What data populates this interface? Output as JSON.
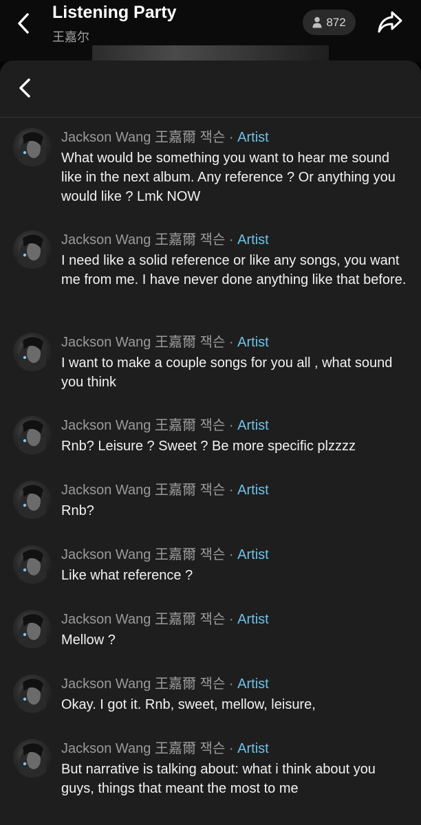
{
  "header": {
    "title": "Listening Party",
    "subtitle": "王嘉尔",
    "listener_count": "872",
    "back_icon": "chevron-left-icon",
    "person_icon": "person-icon",
    "share_icon": "share-arrow-icon"
  },
  "sheet": {
    "back_icon": "chevron-left-icon"
  },
  "colors": {
    "background": "#050505",
    "sheet": "#1e1e1e",
    "name": "#9a9a9a",
    "role": "#6ec3ea",
    "message": "#f2f2f2"
  },
  "messages": [
    {
      "author": "Jackson Wang 王嘉爾 잭슨",
      "separator": "·",
      "role": "Artist",
      "text": "What would be something you want to hear me sound like in the next album. Any reference ? Or anything you would like ? Lmk NOW"
    },
    {
      "author": "Jackson Wang 王嘉爾 잭슨",
      "separator": "·",
      "role": "Artist",
      "text": "I need like a solid reference or like any songs, you want me from me. I have never done anything like that before."
    },
    {
      "author": "Jackson Wang 王嘉爾 잭슨",
      "separator": "·",
      "role": "Artist",
      "text": "I want to make a couple songs for you all , what sound you think"
    },
    {
      "author": "Jackson Wang 王嘉爾 잭슨",
      "separator": "·",
      "role": "Artist",
      "text": "Rnb? Leisure ? Sweet ? Be more specific plzzzz"
    },
    {
      "author": "Jackson Wang 王嘉爾 잭슨",
      "separator": "·",
      "role": "Artist",
      "text": "Rnb?"
    },
    {
      "author": "Jackson Wang 王嘉爾 잭슨",
      "separator": "·",
      "role": "Artist",
      "text": "Like what reference ?"
    },
    {
      "author": "Jackson Wang 王嘉爾 잭슨",
      "separator": "·",
      "role": "Artist",
      "text": "Mellow ?"
    },
    {
      "author": "Jackson Wang 王嘉爾 잭슨",
      "separator": "·",
      "role": "Artist",
      "text": "Okay. I got it. Rnb, sweet, mellow, leisure,"
    },
    {
      "author": "Jackson Wang 王嘉爾 잭슨",
      "separator": "·",
      "role": "Artist",
      "text": "But narrative is talking about: what i think about you guys, things that meant the most to me"
    }
  ]
}
